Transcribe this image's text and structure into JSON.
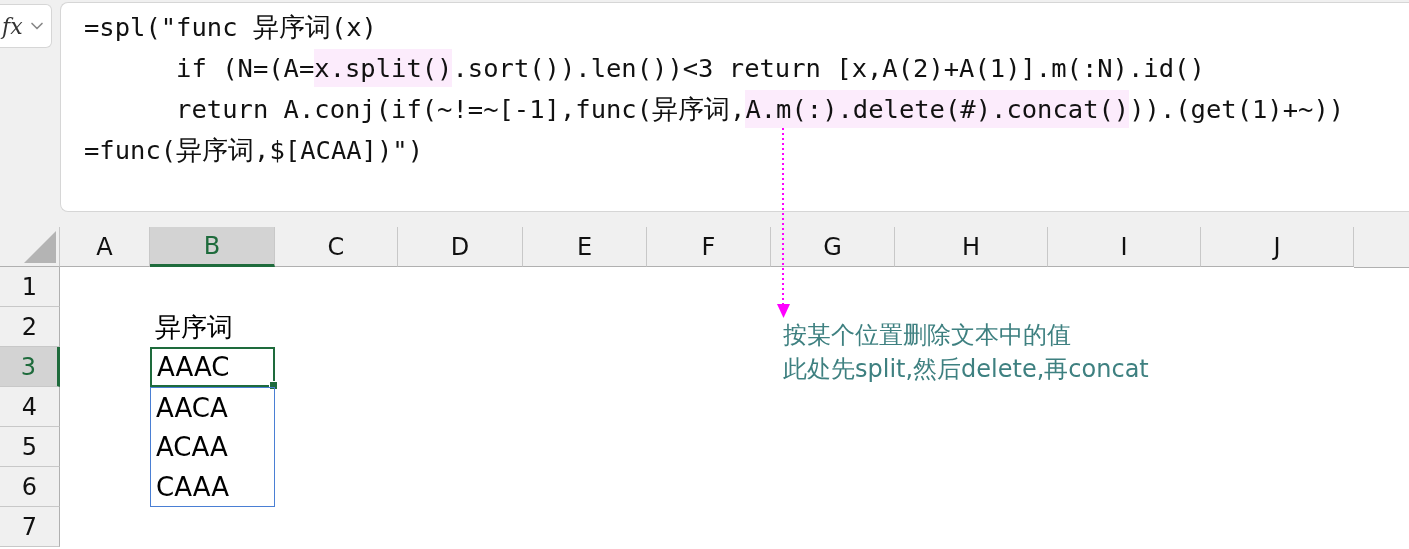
{
  "formula_bar": {
    "function_label": "fx",
    "lines": [
      [
        {
          "text": "=spl(\"func 异序词(x)",
          "highlight": false
        }
      ],
      [
        {
          "text": "      if (N=(A=",
          "highlight": false
        },
        {
          "text": "x.split()",
          "highlight": true
        },
        {
          "text": ".sort()).len())<3 return [x,A(2)+A(1)].m(:N).id()",
          "highlight": false
        }
      ],
      [
        {
          "text": "      return A.conj(if(~!=~[-1],func(异序词,",
          "highlight": false
        },
        {
          "text": "A.m(:).delete(#).concat()",
          "highlight": true
        },
        {
          "text": ")).(get(1)+~))",
          "highlight": false
        }
      ],
      [
        {
          "text": "=func(异序词,$[ACAA])\")",
          "highlight": false
        }
      ]
    ]
  },
  "sheet": {
    "columns": [
      {
        "label": "A",
        "selected": false
      },
      {
        "label": "B",
        "selected": true
      },
      {
        "label": "C",
        "selected": false
      },
      {
        "label": "D",
        "selected": false
      },
      {
        "label": "E",
        "selected": false
      },
      {
        "label": "F",
        "selected": false
      },
      {
        "label": "G",
        "selected": false
      },
      {
        "label": "H",
        "selected": false
      },
      {
        "label": "I",
        "selected": false
      },
      {
        "label": "J",
        "selected": false
      }
    ],
    "rows": [
      {
        "label": "1",
        "selected": false
      },
      {
        "label": "2",
        "selected": false,
        "column_b": {
          "text": "异序词",
          "selected": false,
          "referenced": false
        }
      },
      {
        "label": "3",
        "selected": true,
        "column_b": {
          "text": "AAAC",
          "selected": true,
          "referenced": false
        }
      },
      {
        "label": "4",
        "selected": false,
        "column_b": {
          "text": "AACA",
          "selected": false,
          "referenced": true
        }
      },
      {
        "label": "5",
        "selected": false,
        "column_b": {
          "text": "ACAA",
          "selected": false,
          "referenced": true
        }
      },
      {
        "label": "6",
        "selected": false,
        "column_b": {
          "text": "CAAA",
          "selected": false,
          "referenced": true
        }
      },
      {
        "label": "7",
        "selected": false
      }
    ]
  },
  "annotation": {
    "lines": [
      "按某个位置删除文本中的值",
      "此处先split,然后delete,再concat"
    ]
  }
}
